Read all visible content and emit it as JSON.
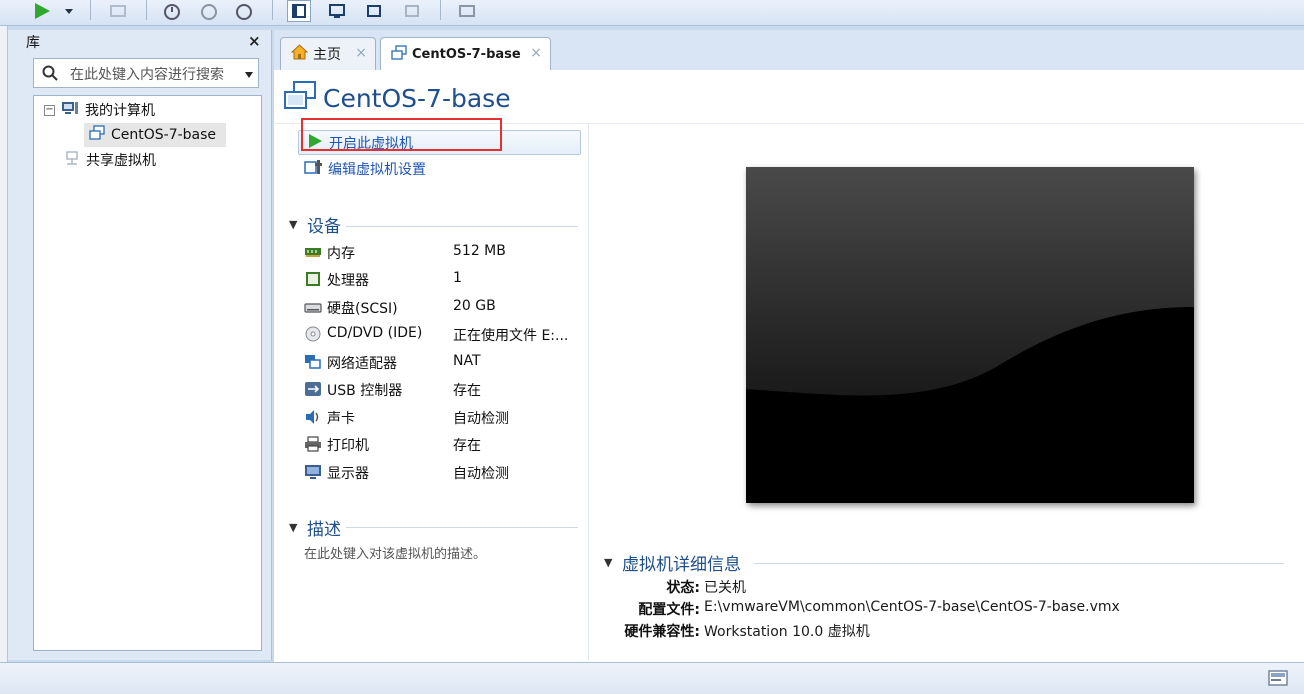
{
  "library": {
    "title": "库",
    "close": "×",
    "search_placeholder": "在此处键入内容进行搜索",
    "tree": {
      "root_expander": "−",
      "root": "我的计算机",
      "vm": "CentOS-7-base",
      "shared": "共享虚拟机"
    }
  },
  "tabs": [
    {
      "label": "主页",
      "close": "×"
    },
    {
      "label": "CentOS-7-base",
      "close": "×"
    }
  ],
  "vm": {
    "title": "CentOS-7-base",
    "power_on": "开启此虚拟机",
    "edit_settings": "编辑虚拟机设置"
  },
  "devices": {
    "heading": "设备",
    "items": [
      {
        "name": "内存",
        "value": "512 MB",
        "icon": "memory-icon"
      },
      {
        "name": "处理器",
        "value": "1",
        "icon": "processor-icon"
      },
      {
        "name": "硬盘(SCSI)",
        "value": "20 GB",
        "icon": "harddisk-icon"
      },
      {
        "name": "CD/DVD (IDE)",
        "value": "正在使用文件 E:...",
        "icon": "cd-dvd-icon"
      },
      {
        "name": "网络适配器",
        "value": "NAT",
        "icon": "network-adapter-icon"
      },
      {
        "name": "USB 控制器",
        "value": "存在",
        "icon": "usb-icon"
      },
      {
        "name": "声卡",
        "value": "自动检测",
        "icon": "sound-card-icon"
      },
      {
        "name": "打印机",
        "value": "存在",
        "icon": "printer-icon"
      },
      {
        "name": "显示器",
        "value": "自动检测",
        "icon": "display-icon"
      }
    ]
  },
  "description": {
    "heading": "描述",
    "placeholder": "在此处键入对该虚拟机的描述。"
  },
  "details": {
    "heading": "虚拟机详细信息",
    "status_label": "状态:",
    "status_value": "已关机",
    "config_label": "配置文件:",
    "config_value": "E:\\vmwareVM\\common\\CentOS-7-base\\CentOS-7-base.vmx",
    "compat_label": "硬件兼容性:",
    "compat_value": "Workstation 10.0 虚拟机"
  },
  "colors": {
    "accent": "#1e4f8c",
    "link": "#1f55b4",
    "highlight": "#e63030",
    "play": "#2fa82f"
  }
}
